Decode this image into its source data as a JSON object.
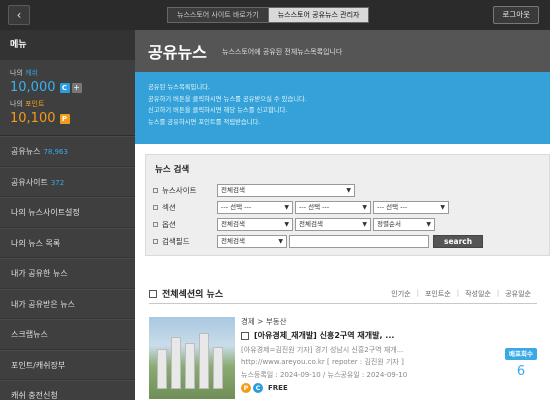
{
  "topbar": {
    "back_icon": "chevron-left-icon",
    "tabs": [
      "뉴스스토어 사이트 바로가기",
      "뉴스스토어 공유뉴스 관리자"
    ],
    "logout_label": "로그아웃"
  },
  "sidebar": {
    "menu_title": "메뉴",
    "cash_label_prefix": "나의 ",
    "cash_label_hl": "캐쉬",
    "cash_value": "10,000",
    "cash_badge": "C",
    "cash_plus": "+",
    "point_label_prefix": "나의 ",
    "point_label_hl": "포인트",
    "point_value": "10,100",
    "point_badge": "P",
    "items": [
      {
        "label": "공유뉴스",
        "count": "78,963"
      },
      {
        "label": "공유사이트",
        "count": "372"
      },
      {
        "label": "나의 뉴스사이트설정",
        "count": ""
      },
      {
        "label": "나의 뉴스 목록",
        "count": ""
      },
      {
        "label": "내가 공유한 뉴스",
        "count": ""
      },
      {
        "label": "내가 공유받은 뉴스",
        "count": ""
      },
      {
        "label": "스크랩뉴스",
        "count": ""
      },
      {
        "label": "포인트/캐쉬장부",
        "count": ""
      },
      {
        "label": "캐쉬 충전신청",
        "count": ""
      }
    ]
  },
  "header": {
    "title": "공유뉴스",
    "subtitle": "뉴스스토어에 공유된 전체뉴스목록입니다"
  },
  "info": {
    "lines": [
      "공유된 뉴스목록입니다.",
      "공유하기 버튼을 클릭하시면 뉴스를 공유받으실 수 있습니다.",
      "신고하기 버튼을 클릭하시면 해당 뉴스를 신고합니다.",
      "뉴스를 공유하시면 포인트를 적립받습니다."
    ]
  },
  "search": {
    "title": "뉴스 검색",
    "site_label": "뉴스사이트",
    "site_value": "전체검색",
    "section_label": "섹션",
    "section_values": [
      "--- 선택 ---",
      "--- 선택 ---",
      "--- 선택 ---"
    ],
    "option_label": "옵션",
    "option_values": [
      "전체검색",
      "전체검색",
      "정렬순서"
    ],
    "field_label": "검색필드",
    "field_value": "전체검색",
    "input_value": "",
    "button_label": "search"
  },
  "list": {
    "title": "전체섹션의 뉴스",
    "sort_links": [
      "인기순",
      "포인트순",
      "작성일순",
      "공유일순"
    ],
    "items": [
      {
        "category": "경제 > 부동산",
        "title": "[아유경제_재개발] 신흥2구역 재개발, ...",
        "desc": "[아유경제=김진원 기자] 경기 성남시 신흥2구역 재개...",
        "url": "http://www.areyou.co.kr [ repoter : 김진원 기자 ]",
        "dates": "뉴스등록일 : 2024-09-10 / 뉴스공유일 : 2024-09-10",
        "badge_p": "P",
        "badge_c": "C",
        "price": "FREE",
        "share_label": "배포회수",
        "share_count": "6"
      }
    ]
  }
}
